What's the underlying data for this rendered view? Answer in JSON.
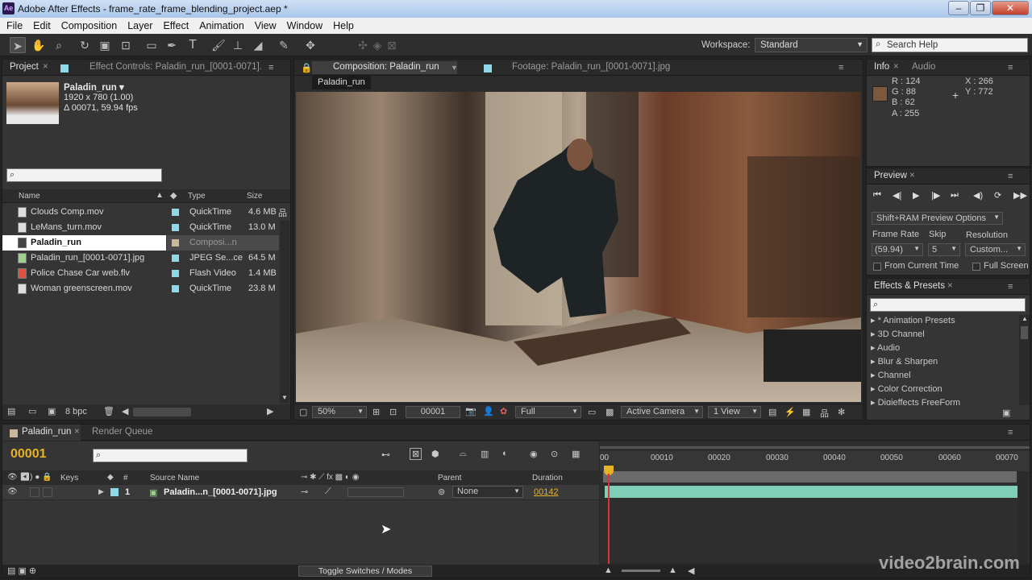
{
  "window": {
    "title": "Adobe After Effects - frame_rate_frame_blending_project.aep *",
    "app_icon": "Ae"
  },
  "menu": [
    "File",
    "Edit",
    "Composition",
    "Layer",
    "Effect",
    "Animation",
    "View",
    "Window",
    "Help"
  ],
  "workspace": {
    "label": "Workspace:",
    "value": "Standard"
  },
  "search_help": {
    "placeholder": "Search Help"
  },
  "project": {
    "tab": "Project",
    "effect_controls_tab": "Effect Controls: Paladin_run_[0001-0071].",
    "selected": {
      "name": "Paladin_run ▾",
      "dims": "1920 x 780 (1.00)",
      "duration": "Δ 00071, 59.94 fps"
    },
    "columns": {
      "name": "Name",
      "type": "Type",
      "size": "Size"
    },
    "items": [
      {
        "name": "Clouds Comp.mov",
        "type": "QuickTime",
        "size": "4.6 MB",
        "color": "#8fd8e8"
      },
      {
        "name": "LeMans_turn.mov",
        "type": "QuickTime",
        "size": "13.0 M",
        "color": "#8fd8e8"
      },
      {
        "name": "Paladin_run",
        "type": "Composi...n",
        "size": "",
        "color": "#c9b998"
      },
      {
        "name": "Paladin_run_[0001-0071].jpg",
        "type": "JPEG Se...ce",
        "size": "64.5 M",
        "color": "#8fd8e8"
      },
      {
        "name": "Police Chase Car web.flv",
        "type": "Flash Video",
        "size": "1.4 MB",
        "color": "#8fd8e8"
      },
      {
        "name": "Woman greenscreen.mov",
        "type": "QuickTime",
        "size": "23.8 M",
        "color": "#8fd8e8"
      }
    ],
    "bpc": "8 bpc"
  },
  "composition": {
    "tab": "Composition: Paladin_run",
    "footage_tab": "Footage: Paladin_run_[0001-0071].jpg",
    "subtab": "Paladin_run",
    "zoom": "50%",
    "timecode": "00001",
    "resolution": "Full",
    "camera": "Active Camera",
    "views": "1 View"
  },
  "info": {
    "tab": "Info",
    "audio_tab": "Audio",
    "r": "R : 124",
    "g": "G : 88",
    "b": "B : 62",
    "a": "A : 255",
    "x": "X : 266",
    "y": "Y : 772",
    "swatch": "#7c583e"
  },
  "preview": {
    "tab": "Preview",
    "options": "Shift+RAM Preview Options",
    "frame_rate_label": "Frame Rate",
    "skip_label": "Skip",
    "resolution_label": "Resolution",
    "frame_rate": "(59.94)",
    "skip": "5",
    "resolution": "Custom...",
    "from_current": "From Current Time",
    "full_screen": "Full Screen"
  },
  "effects": {
    "tab": "Effects & Presets",
    "items": [
      "* Animation Presets",
      "3D Channel",
      "Audio",
      "Blur & Sharpen",
      "Channel",
      "Color Correction",
      "Digieffects FreeForm"
    ]
  },
  "timeline": {
    "tab": "Paladin_run",
    "render_tab": "Render Queue",
    "current_time": "00001",
    "cols": {
      "keys": "Keys",
      "num": "#",
      "source": "Source Name",
      "parent": "Parent",
      "duration": "Duration"
    },
    "layer": {
      "num": "1",
      "name": "Paladin...n_[0001-0071].jpg",
      "parent": "None",
      "duration": "00142"
    },
    "ruler": [
      "00010",
      "00020",
      "00030",
      "00040",
      "00050",
      "00060",
      "00070"
    ],
    "ruler_start": "00",
    "toggle": "Toggle Switches / Modes"
  },
  "watermark": "video2brain.com"
}
